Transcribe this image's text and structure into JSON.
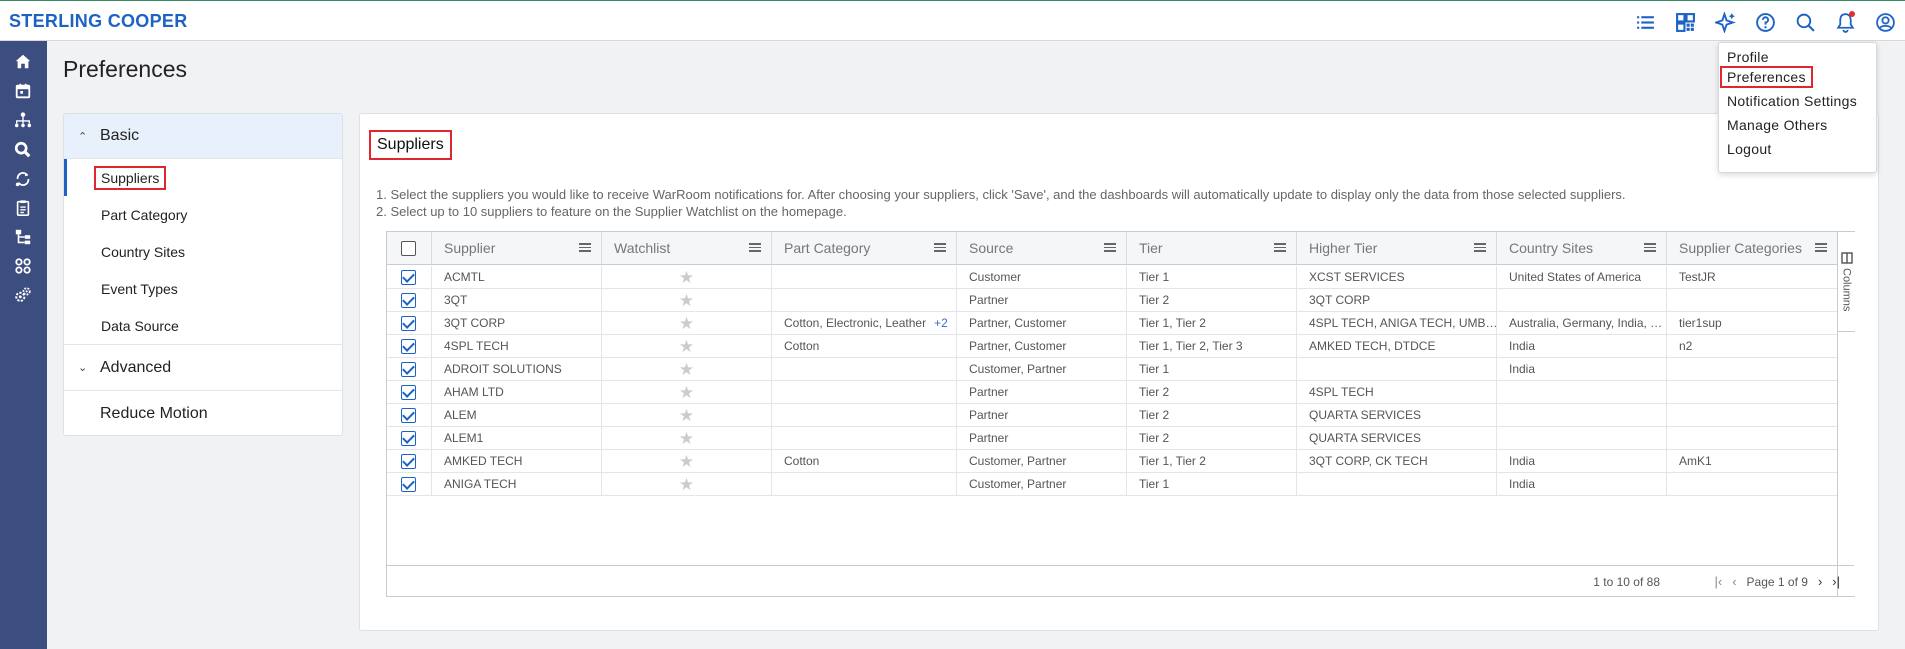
{
  "app": {
    "brand": "STERLING COOPER"
  },
  "header_icons": [
    "list-icon",
    "dashboard-icon",
    "sparkle-icon",
    "help-icon",
    "search-icon",
    "bell-icon",
    "user-icon"
  ],
  "rail_icons": [
    "home-icon",
    "calendar-icon",
    "network-icon",
    "search-zoom-icon",
    "cycle-icon",
    "clipboard-icon",
    "hierarchy-icon",
    "apps-icon",
    "gear-group-icon"
  ],
  "page": {
    "title": "Preferences"
  },
  "left_panel": {
    "basic": "Basic",
    "basic_items": [
      "Suppliers",
      "Part Category",
      "Country Sites",
      "Event Types",
      "Data Source"
    ],
    "advanced": "Advanced",
    "reduce_motion": "Reduce Motion"
  },
  "main": {
    "title": "Suppliers",
    "instruction_1": "1. Select the suppliers you would like to receive WarRoom notifications for. After choosing your suppliers, click 'Save', and the dashboards will automatically update to display only the data from those selected suppliers.",
    "instruction_2": "2. Select up to 10 suppliers to feature on the Supplier Watchlist on the homepage."
  },
  "grid": {
    "columns": [
      "Supplier",
      "Watchlist",
      "Part Category",
      "Source",
      "Tier",
      "Higher Tier",
      "Country Sites",
      "Supplier Categories"
    ],
    "rows": [
      {
        "supplier": "ACMTL",
        "part": "",
        "part_more": "",
        "source": "Customer",
        "tier": "Tier 1",
        "higher": "XCST SERVICES",
        "country": "United States of America",
        "categories": "TestJR"
      },
      {
        "supplier": "3QT",
        "part": "",
        "part_more": "",
        "source": "Partner",
        "tier": "Tier 2",
        "higher": "3QT CORP",
        "country": "",
        "categories": ""
      },
      {
        "supplier": "3QT CORP",
        "part": "Cotton, Electronic, Leather",
        "part_more": "+2",
        "source": "Partner, Customer",
        "tier": "Tier 1, Tier 2",
        "higher": "4SPL TECH, ANIGA TECH, UMB…",
        "country": "Australia, Germany, India, …",
        "categories": "tier1sup"
      },
      {
        "supplier": "4SPL TECH",
        "part": "Cotton",
        "part_more": "",
        "source": "Partner, Customer",
        "tier": "Tier 1, Tier 2, Tier 3",
        "higher": "AMKED TECH, DTDCE",
        "country": "India",
        "categories": "n2"
      },
      {
        "supplier": "ADROIT SOLUTIONS",
        "part": "",
        "part_more": "",
        "source": "Customer, Partner",
        "tier": "Tier 1",
        "higher": "",
        "country": "India",
        "categories": ""
      },
      {
        "supplier": "AHAM LTD",
        "part": "",
        "part_more": "",
        "source": "Partner",
        "tier": "Tier 2",
        "higher": "4SPL TECH",
        "country": "",
        "categories": ""
      },
      {
        "supplier": "ALEM",
        "part": "",
        "part_more": "",
        "source": "Partner",
        "tier": "Tier 2",
        "higher": "QUARTA SERVICES",
        "country": "",
        "categories": ""
      },
      {
        "supplier": "ALEM1",
        "part": "",
        "part_more": "",
        "source": "Partner",
        "tier": "Tier 2",
        "higher": "QUARTA SERVICES",
        "country": "",
        "categories": ""
      },
      {
        "supplier": "AMKED TECH",
        "part": "Cotton",
        "part_more": "",
        "source": "Customer, Partner",
        "tier": "Tier 1, Tier 2",
        "higher": "3QT CORP, CK TECH",
        "country": "India",
        "categories": "AmK1"
      },
      {
        "supplier": "ANIGA TECH",
        "part": "",
        "part_more": "",
        "source": "Customer, Partner",
        "tier": "Tier 1",
        "higher": "",
        "country": "India",
        "categories": ""
      }
    ],
    "side_tab": "Columns",
    "summary": "1 to 10 of 88",
    "page_label": "Page 1 of 9"
  },
  "profile_menu": [
    "Profile",
    "Preferences",
    "Notification Settings",
    "Manage Others",
    "Logout"
  ]
}
